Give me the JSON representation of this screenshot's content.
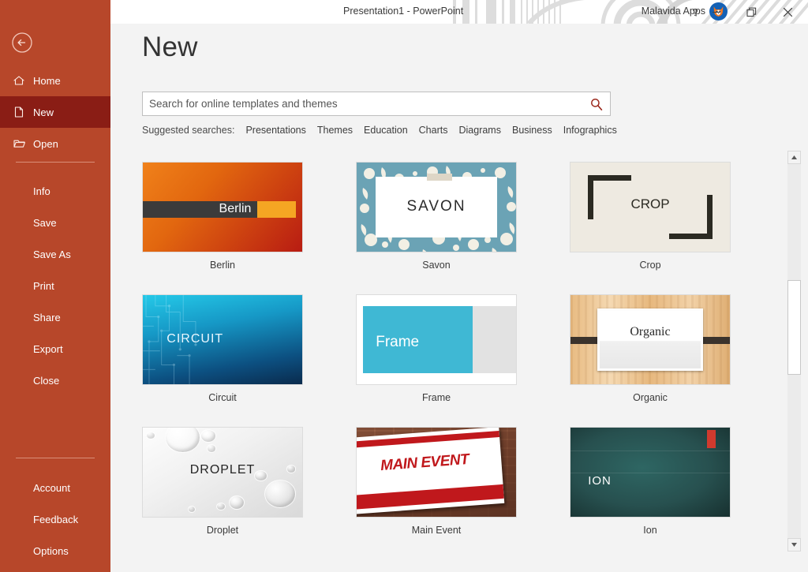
{
  "titlebar": {
    "document_title": "Presentation1  -  PowerPoint",
    "account_name": "Malavida Apps",
    "help_label": "?",
    "minimize_label": "–",
    "restore_label": "❐",
    "close_label": "✕",
    "avatar_name": "fox-avatar"
  },
  "sidebar": {
    "background_color": "#b7472a",
    "selected_color": "#8a1d15",
    "back_label": "Back",
    "top_items": [
      {
        "label": "Home",
        "icon": "home-icon",
        "selected": false
      },
      {
        "label": "New",
        "icon": "new-document-icon",
        "selected": true
      },
      {
        "label": "Open",
        "icon": "open-folder-icon",
        "selected": false
      }
    ],
    "mid_items": [
      {
        "label": "Info"
      },
      {
        "label": "Save"
      },
      {
        "label": "Save As"
      },
      {
        "label": "Print"
      },
      {
        "label": "Share"
      },
      {
        "label": "Export"
      },
      {
        "label": "Close"
      }
    ],
    "bottom_items": [
      {
        "label": "Account"
      },
      {
        "label": "Feedback"
      },
      {
        "label": "Options"
      }
    ]
  },
  "main": {
    "page_title": "New",
    "search": {
      "placeholder": "Search for online templates and themes",
      "value": "",
      "icon": "search-icon",
      "icon_color": "#9c2a1e"
    },
    "suggested": {
      "label": "Suggested searches:",
      "links": [
        "Presentations",
        "Themes",
        "Education",
        "Charts",
        "Diagrams",
        "Business",
        "Infographics"
      ]
    },
    "templates": [
      {
        "label": "Berlin",
        "title_text": "Berlin",
        "theme": "berlin"
      },
      {
        "label": "Savon",
        "title_text": "SAVON",
        "theme": "savon"
      },
      {
        "label": "Crop",
        "title_text": "CROP",
        "theme": "crop"
      },
      {
        "label": "Circuit",
        "title_text": "CIRCUIT",
        "theme": "circuit"
      },
      {
        "label": "Frame",
        "title_text": "Frame",
        "theme": "frame"
      },
      {
        "label": "Organic",
        "title_text": "Organic",
        "theme": "organic"
      },
      {
        "label": "Droplet",
        "title_text": "DROPLET",
        "theme": "droplet"
      },
      {
        "label": "Main Event",
        "title_text": "MAIN EVENT",
        "theme": "mainevent"
      },
      {
        "label": "Ion",
        "title_text": "ION",
        "theme": "ion"
      }
    ],
    "scrollbar": {
      "up_arrow": "▲",
      "down_arrow": "▼"
    }
  }
}
